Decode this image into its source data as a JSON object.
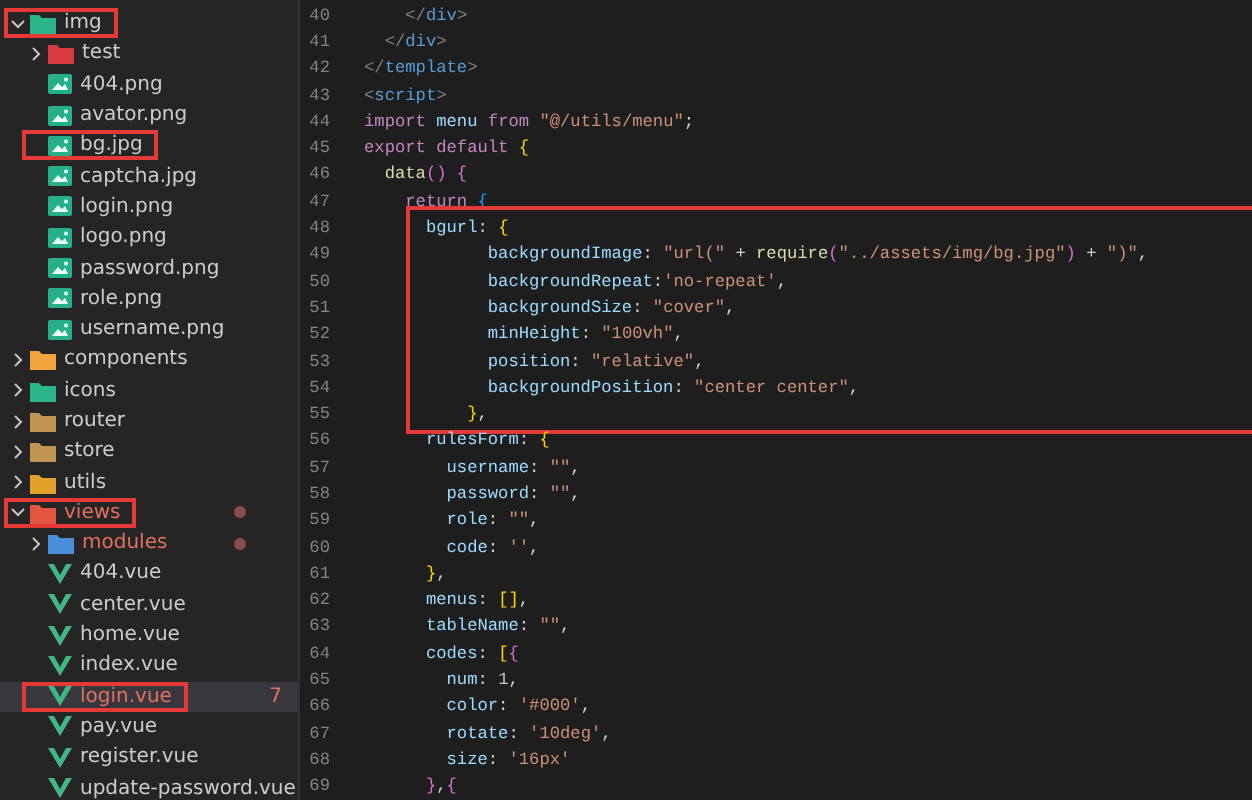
{
  "explorer": {
    "items": [
      {
        "name": "img",
        "kind": "folder",
        "color": "#2bb58a",
        "expanded": true,
        "selected": false,
        "modified": false,
        "boxed": true,
        "children": [
          {
            "name": "test",
            "kind": "folder",
            "color": "#d6393e",
            "expanded": false,
            "selected": false,
            "modified": false,
            "boxed": false
          },
          {
            "name": "404.png",
            "kind": "image",
            "selected": false,
            "modified": false,
            "boxed": false
          },
          {
            "name": "avator.png",
            "kind": "image",
            "selected": false,
            "modified": false,
            "boxed": false
          },
          {
            "name": "bg.jpg",
            "kind": "image",
            "selected": false,
            "modified": false,
            "boxed": true
          },
          {
            "name": "captcha.jpg",
            "kind": "image",
            "selected": false,
            "modified": false,
            "boxed": false
          },
          {
            "name": "login.png",
            "kind": "image",
            "selected": false,
            "modified": false,
            "boxed": false
          },
          {
            "name": "logo.png",
            "kind": "image",
            "selected": false,
            "modified": false,
            "boxed": false
          },
          {
            "name": "password.png",
            "kind": "image",
            "selected": false,
            "modified": false,
            "boxed": false
          },
          {
            "name": "role.png",
            "kind": "image",
            "selected": false,
            "modified": false,
            "boxed": false
          },
          {
            "name": "username.png",
            "kind": "image",
            "selected": false,
            "modified": false,
            "boxed": false
          }
        ]
      },
      {
        "name": "components",
        "kind": "folder",
        "color": "#f0a43a",
        "expanded": false,
        "selected": false,
        "modified": false,
        "boxed": false
      },
      {
        "name": "icons",
        "kind": "folder",
        "color": "#2bb58a",
        "expanded": false,
        "selected": false,
        "modified": false,
        "boxed": false
      },
      {
        "name": "router",
        "kind": "folder",
        "color": "#c09553",
        "expanded": false,
        "selected": false,
        "modified": false,
        "boxed": false
      },
      {
        "name": "store",
        "kind": "folder",
        "color": "#c09553",
        "expanded": false,
        "selected": false,
        "modified": false,
        "boxed": false
      },
      {
        "name": "utils",
        "kind": "folder",
        "color": "#e2a229",
        "expanded": false,
        "selected": false,
        "modified": false,
        "boxed": false
      },
      {
        "name": "views",
        "kind": "folder",
        "color": "#e2553f",
        "expanded": true,
        "selected": false,
        "modified": true,
        "boxed": true,
        "children": [
          {
            "name": "modules",
            "kind": "folder",
            "color": "#4a8fd9",
            "expanded": false,
            "selected": false,
            "modified": true,
            "boxed": false
          },
          {
            "name": "404.vue",
            "kind": "vue",
            "selected": false,
            "modified": false,
            "boxed": false
          },
          {
            "name": "center.vue",
            "kind": "vue",
            "selected": false,
            "modified": false,
            "boxed": false
          },
          {
            "name": "home.vue",
            "kind": "vue",
            "selected": false,
            "modified": false,
            "boxed": false
          },
          {
            "name": "index.vue",
            "kind": "vue",
            "selected": false,
            "modified": false,
            "boxed": false
          },
          {
            "name": "login.vue",
            "kind": "vue",
            "selected": true,
            "modified": true,
            "boxed": true,
            "badge": "7"
          },
          {
            "name": "pay.vue",
            "kind": "vue",
            "selected": false,
            "modified": false,
            "boxed": false
          },
          {
            "name": "register.vue",
            "kind": "vue",
            "selected": false,
            "modified": false,
            "boxed": false
          },
          {
            "name": "update-password.vue",
            "kind": "vue",
            "selected": false,
            "modified": false,
            "boxed": false
          }
        ]
      }
    ]
  },
  "code": {
    "sections": [
      {
        "boxed": false,
        "lines": [
          {
            "number": "40",
            "tokens": [
              {
                "t": "    </",
                "kind": "punct"
              },
              {
                "t": "div",
                "kind": "tag"
              },
              {
                "t": ">",
                "kind": "punct"
              }
            ]
          },
          {
            "number": "41",
            "tokens": [
              {
                "t": "  </",
                "kind": "punct"
              },
              {
                "t": "div",
                "kind": "tag"
              },
              {
                "t": ">",
                "kind": "punct"
              }
            ]
          },
          {
            "number": "42",
            "tokens": [
              {
                "t": "</",
                "kind": "punct"
              },
              {
                "t": "template",
                "kind": "tag"
              },
              {
                "t": ">",
                "kind": "punct"
              }
            ]
          },
          {
            "number": "43",
            "tokens": [
              {
                "t": "<",
                "kind": "punct"
              },
              {
                "t": "script",
                "kind": "tag"
              },
              {
                "t": ">",
                "kind": "punct"
              }
            ]
          },
          {
            "number": "44",
            "tokens": [
              {
                "t": "import ",
                "kind": "keyword"
              },
              {
                "t": "menu ",
                "kind": "variable"
              },
              {
                "t": "from ",
                "kind": "keyword"
              },
              {
                "t": "\"@/utils/menu\"",
                "kind": "string"
              },
              {
                "t": ";",
                "kind": "plain"
              }
            ]
          },
          {
            "number": "45",
            "tokens": [
              {
                "t": "export default ",
                "kind": "keyword"
              },
              {
                "t": "{",
                "kind": "gold"
              }
            ]
          },
          {
            "number": "46",
            "tokens": [
              {
                "t": "  data",
                "kind": "function"
              },
              {
                "t": "() {",
                "kind": "orchid"
              }
            ]
          },
          {
            "number": "47",
            "tokens": [
              {
                "t": "    return ",
                "kind": "keyword"
              },
              {
                "t": "{",
                "kind": "blue"
              }
            ]
          }
        ]
      },
      {
        "boxed": true,
        "lines": [
          {
            "number": "48",
            "tokens": [
              {
                "t": "      bgurl",
                "kind": "variable"
              },
              {
                "t": ": ",
                "kind": "plain"
              },
              {
                "t": "{",
                "kind": "gold"
              }
            ]
          },
          {
            "number": "49",
            "tokens": [
              {
                "t": "            backgroundImage",
                "kind": "variable"
              },
              {
                "t": ": ",
                "kind": "plain"
              },
              {
                "t": "\"url(\"",
                "kind": "string"
              },
              {
                "t": " + ",
                "kind": "plain"
              },
              {
                "t": "require",
                "kind": "function"
              },
              {
                "t": "(",
                "kind": "orchid"
              },
              {
                "t": "\"../assets/img/bg.jpg\"",
                "kind": "string"
              },
              {
                "t": ")",
                "kind": "orchid"
              },
              {
                "t": " + ",
                "kind": "plain"
              },
              {
                "t": "\")\"",
                "kind": "string"
              },
              {
                "t": ",",
                "kind": "plain"
              }
            ]
          },
          {
            "number": "50",
            "tokens": [
              {
                "t": "            backgroundRepeat",
                "kind": "variable"
              },
              {
                "t": ":",
                "kind": "plain"
              },
              {
                "t": "'no-repeat'",
                "kind": "string"
              },
              {
                "t": ",",
                "kind": "plain"
              }
            ]
          },
          {
            "number": "51",
            "tokens": [
              {
                "t": "            backgroundSize",
                "kind": "variable"
              },
              {
                "t": ": ",
                "kind": "plain"
              },
              {
                "t": "\"cover\"",
                "kind": "string"
              },
              {
                "t": ",",
                "kind": "plain"
              }
            ]
          },
          {
            "number": "52",
            "tokens": [
              {
                "t": "            minHeight",
                "kind": "variable"
              },
              {
                "t": ": ",
                "kind": "plain"
              },
              {
                "t": "\"100vh\"",
                "kind": "string"
              },
              {
                "t": ",",
                "kind": "plain"
              }
            ]
          },
          {
            "number": "53",
            "tokens": [
              {
                "t": "            position",
                "kind": "variable"
              },
              {
                "t": ": ",
                "kind": "plain"
              },
              {
                "t": "\"relative\"",
                "kind": "string"
              },
              {
                "t": ",",
                "kind": "plain"
              }
            ]
          },
          {
            "number": "54",
            "tokens": [
              {
                "t": "            backgroundPosition",
                "kind": "variable"
              },
              {
                "t": ": ",
                "kind": "plain"
              },
              {
                "t": "\"center center\"",
                "kind": "string"
              },
              {
                "t": ",",
                "kind": "plain"
              }
            ]
          },
          {
            "number": "55",
            "tokens": [
              {
                "t": "          }",
                "kind": "gold"
              },
              {
                "t": ",",
                "kind": "plain"
              }
            ]
          }
        ]
      },
      {
        "boxed": false,
        "lines": [
          {
            "number": "56",
            "tokens": [
              {
                "t": "      rulesForm",
                "kind": "variable"
              },
              {
                "t": ": ",
                "kind": "plain"
              },
              {
                "t": "{",
                "kind": "gold"
              }
            ]
          },
          {
            "number": "57",
            "tokens": [
              {
                "t": "        username",
                "kind": "variable"
              },
              {
                "t": ": ",
                "kind": "plain"
              },
              {
                "t": "\"\"",
                "kind": "string"
              },
              {
                "t": ",",
                "kind": "plain"
              }
            ]
          },
          {
            "number": "58",
            "tokens": [
              {
                "t": "        password",
                "kind": "variable"
              },
              {
                "t": ": ",
                "kind": "plain"
              },
              {
                "t": "\"\"",
                "kind": "string"
              },
              {
                "t": ",",
                "kind": "plain"
              }
            ]
          },
          {
            "number": "59",
            "tokens": [
              {
                "t": "        role",
                "kind": "variable"
              },
              {
                "t": ": ",
                "kind": "plain"
              },
              {
                "t": "\"\"",
                "kind": "string"
              },
              {
                "t": ",",
                "kind": "plain"
              }
            ]
          },
          {
            "number": "60",
            "tokens": [
              {
                "t": "        code",
                "kind": "variable"
              },
              {
                "t": ": ",
                "kind": "plain"
              },
              {
                "t": "''",
                "kind": "string"
              },
              {
                "t": ",",
                "kind": "plain"
              }
            ]
          },
          {
            "number": "61",
            "tokens": [
              {
                "t": "      }",
                "kind": "gold"
              },
              {
                "t": ",",
                "kind": "plain"
              }
            ]
          },
          {
            "number": "62",
            "tokens": [
              {
                "t": "      menus",
                "kind": "variable"
              },
              {
                "t": ": ",
                "kind": "plain"
              },
              {
                "t": "[]",
                "kind": "gold"
              },
              {
                "t": ",",
                "kind": "plain"
              }
            ]
          },
          {
            "number": "63",
            "tokens": [
              {
                "t": "      tableName",
                "kind": "variable"
              },
              {
                "t": ": ",
                "kind": "plain"
              },
              {
                "t": "\"\"",
                "kind": "string"
              },
              {
                "t": ",",
                "kind": "plain"
              }
            ]
          },
          {
            "number": "64",
            "tokens": [
              {
                "t": "      codes",
                "kind": "variable"
              },
              {
                "t": ": ",
                "kind": "plain"
              },
              {
                "t": "[",
                "kind": "gold"
              },
              {
                "t": "{",
                "kind": "orchid"
              }
            ]
          },
          {
            "number": "65",
            "tokens": [
              {
                "t": "        num",
                "kind": "variable"
              },
              {
                "t": ": ",
                "kind": "plain"
              },
              {
                "t": "1",
                "kind": "number"
              },
              {
                "t": ",",
                "kind": "plain"
              }
            ]
          },
          {
            "number": "66",
            "tokens": [
              {
                "t": "        color",
                "kind": "variable"
              },
              {
                "t": ": ",
                "kind": "plain"
              },
              {
                "t": "'#000'",
                "kind": "string"
              },
              {
                "t": ",",
                "kind": "plain"
              }
            ]
          },
          {
            "number": "67",
            "tokens": [
              {
                "t": "        rotate",
                "kind": "variable"
              },
              {
                "t": ": ",
                "kind": "plain"
              },
              {
                "t": "'10deg'",
                "kind": "string"
              },
              {
                "t": ",",
                "kind": "plain"
              }
            ]
          },
          {
            "number": "68",
            "tokens": [
              {
                "t": "        size",
                "kind": "variable"
              },
              {
                "t": ": ",
                "kind": "plain"
              },
              {
                "t": "'16px'",
                "kind": "string"
              }
            ]
          },
          {
            "number": "69",
            "tokens": [
              {
                "t": "      }",
                "kind": "orchid"
              },
              {
                "t": ",",
                "kind": "plain"
              },
              {
                "t": "{",
                "kind": "orchid"
              }
            ]
          }
        ]
      }
    ]
  }
}
